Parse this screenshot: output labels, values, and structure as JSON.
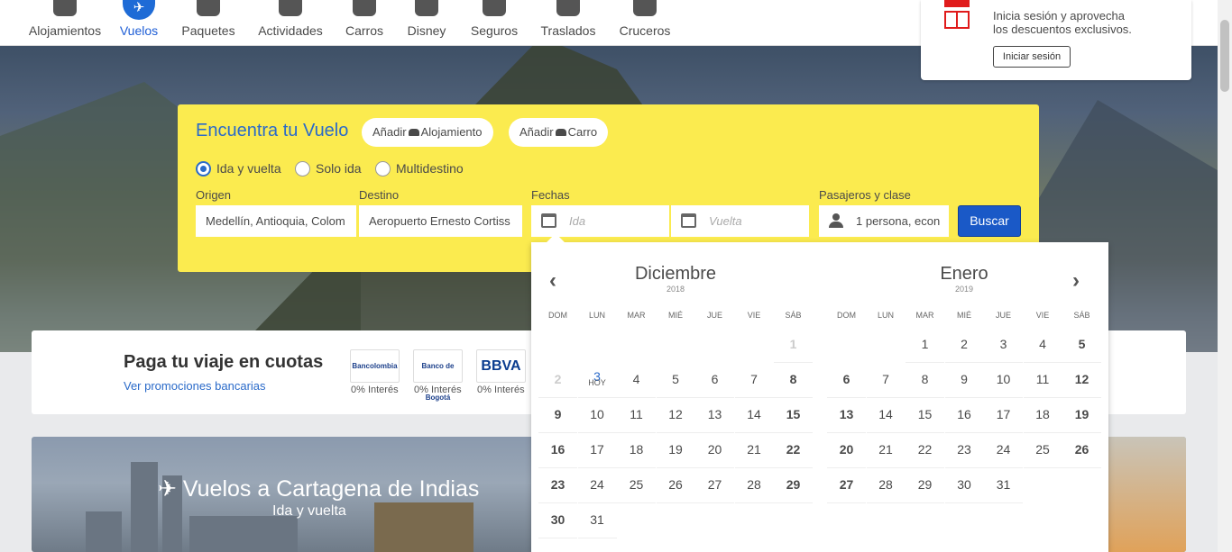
{
  "nav": [
    {
      "label": "Alojamientos",
      "icon": "bell-hotel-icon"
    },
    {
      "label": "Vuelos",
      "icon": "plane-icon",
      "active": true
    },
    {
      "label": "Paquetes",
      "icon": "suitcase-icon"
    },
    {
      "label": "Actividades",
      "icon": "ticket-icon"
    },
    {
      "label": "Carros",
      "icon": "car-icon"
    },
    {
      "label": "Disney",
      "icon": "mickey-icon"
    },
    {
      "label": "Seguros",
      "icon": "medkit-icon"
    },
    {
      "label": "Traslados",
      "icon": "shuttle-icon"
    },
    {
      "label": "Cruceros",
      "icon": "ship-icon"
    }
  ],
  "login": {
    "line1": "Inicia sesión y aprovecha",
    "line2": "los descuentos exclusivos.",
    "button": "Iniciar sesión"
  },
  "search": {
    "title": "Encuentra tu Vuelo",
    "add_hotel": "Añadir Alojamiento",
    "add_hotel_prefix": "Añadir",
    "add_hotel_suffix": "Alojamiento",
    "add_car_prefix": "Añadir",
    "add_car_suffix": "Carro",
    "trip_types": [
      "Ida y vuelta",
      "Solo ida",
      "Multidestino"
    ],
    "selected_trip": "Ida y vuelta",
    "labels": {
      "origin": "Origen",
      "destination": "Destino",
      "dates": "Fechas",
      "passengers": "Pasajeros y clase"
    },
    "origin_value": "Medellín, Antioquia, Colom",
    "destination_value": "Aeropuerto Ernesto Cortiss",
    "depart_placeholder": "Ida",
    "return_placeholder": "Vuelta",
    "passengers_value": "1 persona, econ",
    "submit": "Buscar"
  },
  "calendar": {
    "weekdays": [
      "DOM",
      "LUN",
      "MAR",
      "MIÉ",
      "JUE",
      "VIE",
      "SÁB"
    ],
    "today_label": "HOY",
    "months": [
      {
        "name": "Diciembre",
        "year": "2018",
        "weeks": [
          [
            "",
            "",
            "",
            "",
            "",
            "",
            "1"
          ],
          [
            "2",
            "3",
            "4",
            "5",
            "6",
            "7",
            "8"
          ],
          [
            "9",
            "10",
            "11",
            "12",
            "13",
            "14",
            "15"
          ],
          [
            "16",
            "17",
            "18",
            "19",
            "20",
            "21",
            "22"
          ],
          [
            "23",
            "24",
            "25",
            "26",
            "27",
            "28",
            "29"
          ],
          [
            "30",
            "31",
            "",
            "",
            "",
            "",
            ""
          ]
        ]
      },
      {
        "name": "Enero",
        "year": "2019",
        "weeks": [
          [
            "",
            "",
            "1",
            "2",
            "3",
            "4",
            "5"
          ],
          [
            "6",
            "7",
            "8",
            "9",
            "10",
            "11",
            "12"
          ],
          [
            "13",
            "14",
            "15",
            "16",
            "17",
            "18",
            "19"
          ],
          [
            "20",
            "21",
            "22",
            "23",
            "24",
            "25",
            "26"
          ],
          [
            "27",
            "28",
            "29",
            "30",
            "31",
            "",
            ""
          ]
        ]
      }
    ]
  },
  "installments": {
    "title": "Paga tu viaje en cuotas",
    "link": "Ver promociones bancarias",
    "banks": [
      {
        "name": "Bancolombia",
        "interest": "0% Interés"
      },
      {
        "name": "Banco de Bogotá",
        "interest": "0% Interés"
      },
      {
        "name": "BBVA",
        "interest": "0% Interés"
      }
    ]
  },
  "promo": {
    "title": "Vuelos a Cartagena de Indias",
    "subtitle": "Ida y vuelta"
  }
}
